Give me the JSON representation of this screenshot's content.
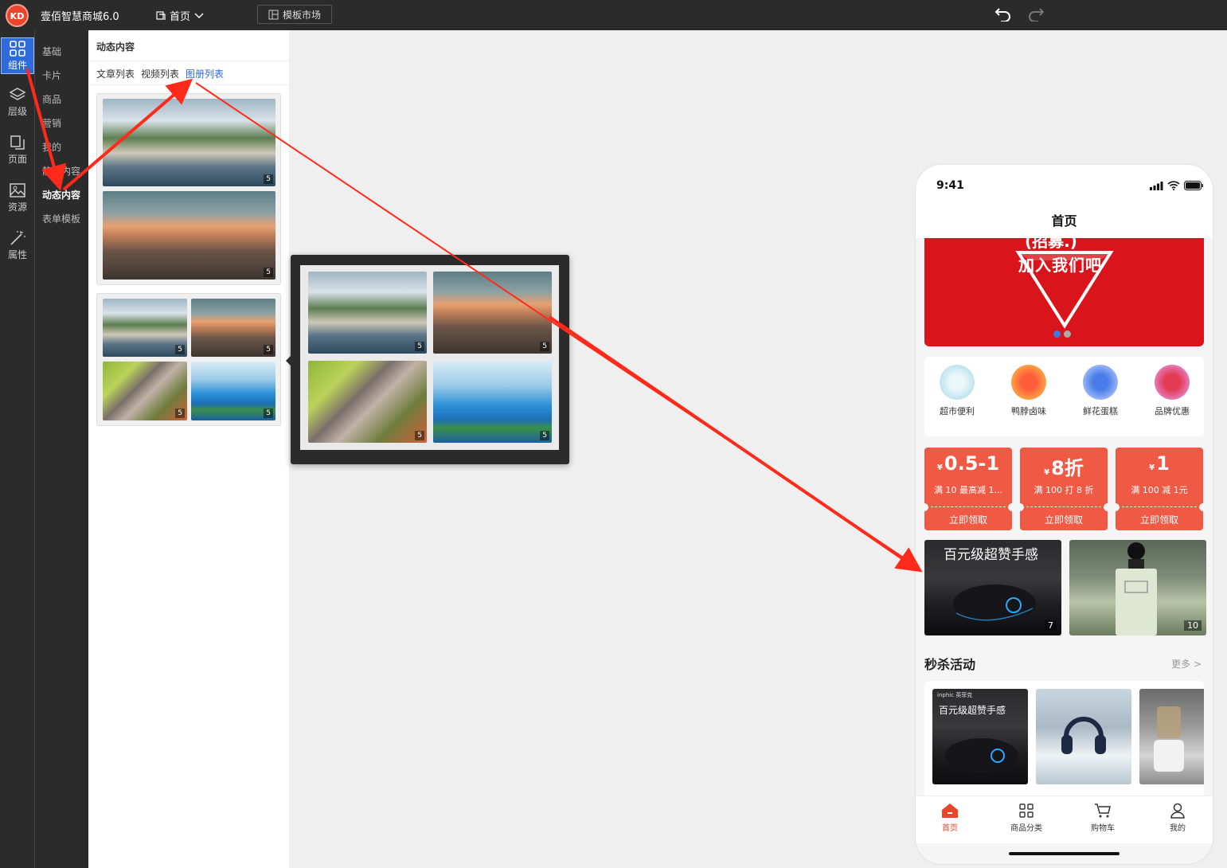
{
  "topbar": {
    "logo_text": "KD",
    "app_title": "壹佰智慧商城6.0",
    "page_switch": "首页",
    "template_market": "模板市场"
  },
  "rail": [
    {
      "label": "组件",
      "icon": "grid-icon",
      "active": true
    },
    {
      "label": "层级",
      "icon": "layers-icon"
    },
    {
      "label": "页面",
      "icon": "pages-icon"
    },
    {
      "label": "资源",
      "icon": "image-icon"
    },
    {
      "label": "属性",
      "icon": "magic-wand-icon"
    }
  ],
  "categories": [
    "基础",
    "卡片",
    "商品",
    "营销",
    "我的",
    "静态内容",
    "动态内容",
    "表单模板"
  ],
  "active_category": "动态内容",
  "panel": {
    "title": "动态内容",
    "tabs": [
      "文章列表",
      "视频列表",
      "图册列表"
    ],
    "active_tab": "图册列表",
    "image_count": "5"
  },
  "phone": {
    "time": "9:41",
    "page_title": "首页",
    "banner_top": "(招募.)",
    "banner_text": "加入我们吧",
    "categories": [
      "超市便利",
      "鸭脖卤味",
      "鲜花蛋糕",
      "品牌优惠"
    ],
    "coupons": [
      {
        "symbol": "¥",
        "value": "0.5-1",
        "condition": "满 10 最高减 1...",
        "button": "立即领取"
      },
      {
        "symbol": "¥",
        "value": "8折",
        "condition": "满 100 打 8 折",
        "button": "立即领取"
      },
      {
        "symbol": "¥",
        "value": "1",
        "condition": "满 100 减 1元",
        "button": "立即领取"
      }
    ],
    "promos": [
      {
        "title": "百元级超赞手感",
        "count": "7"
      },
      {
        "title": "",
        "count": "10"
      }
    ],
    "flash_sale": {
      "title": "秒杀活动",
      "more": "更多 >",
      "item_brand": "inphic 英菲克",
      "item_caption": "百元级超赞手感"
    },
    "tabbar": [
      "首页",
      "商品分类",
      "购物车",
      "我的"
    ]
  },
  "colors": {
    "accent": "#2e6ad9",
    "brand": "#e8452c",
    "annotation": "#ff2a1a",
    "coupon": "#f05a44"
  }
}
